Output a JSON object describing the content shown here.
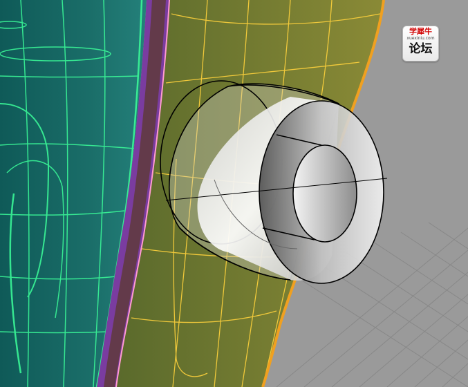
{
  "watermark": {
    "top_text": "学犀牛",
    "url_text": "xuexiniu.com",
    "bottom_text": "论坛"
  },
  "viewport": {
    "background_color": "#9a9a9a",
    "grid_color": "#8a8a8a",
    "surface_teal": "#1f7a72",
    "surface_olive": "#6e7a2e",
    "surface_purple": "#7a3ca0",
    "isocurve_green": "#3cff9a",
    "isocurve_yellow": "#ffd23c",
    "edge_orange": "#f0a020",
    "cylinder_edge": "#000000"
  }
}
